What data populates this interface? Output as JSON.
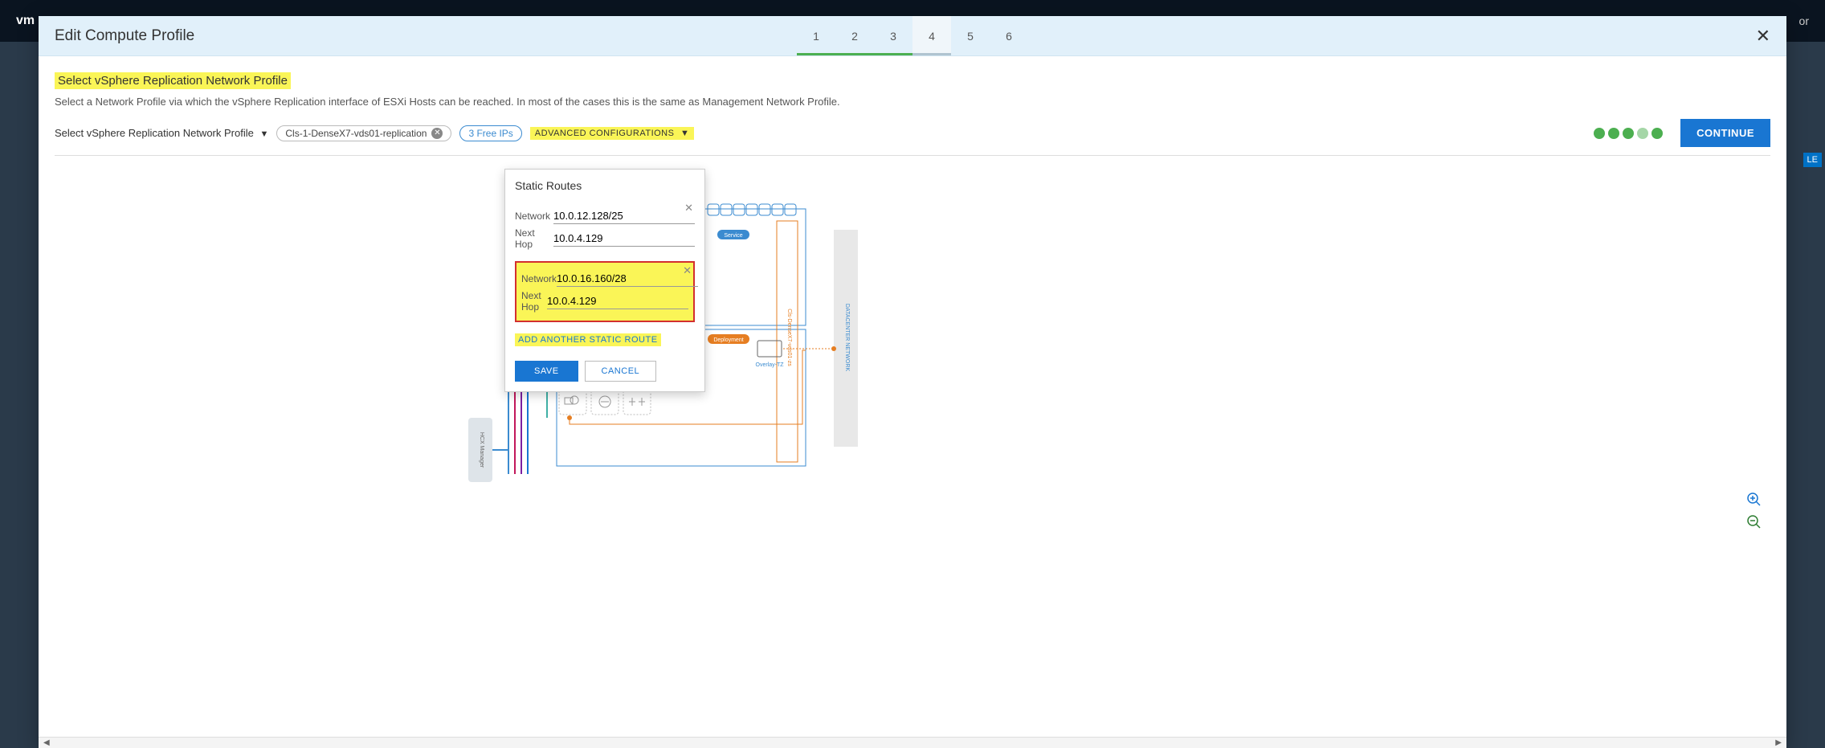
{
  "topbar": {
    "logo": "vm",
    "right": "or"
  },
  "header": {
    "title": "Edit Compute Profile",
    "tabs": [
      "1",
      "2",
      "3",
      "4",
      "5",
      "6"
    ],
    "completed_tabs": [
      0,
      1,
      2
    ],
    "active_tab": 3
  },
  "page": {
    "section_title": "Select vSphere Replication Network Profile",
    "section_desc": "Select a Network Profile via which the vSphere Replication interface of ESXi Hosts can be reached. In most of the cases this is the same as Management Network Profile.",
    "selector_label": "Select vSphere Replication Network Profile",
    "chip_profile": "Cls-1-DenseX7-vds01-replication",
    "chip_ips": "3 Free IPs",
    "adv_label": "ADVANCED CONFIGURATIONS",
    "continue_label": "CONTINUE"
  },
  "popup": {
    "title": "Static Routes",
    "routes": [
      {
        "network_label": "Network",
        "network": "10.0.12.128/25",
        "hop_label": "Next Hop",
        "hop": "10.0.4.129",
        "highlight": false
      },
      {
        "network_label": "Network",
        "network": "10.0.16.160/28",
        "hop_label": "Next Hop",
        "hop": "10.0.4.129",
        "highlight": true
      }
    ],
    "add_label": "ADD ANOTHER STATIC ROUTE",
    "save_label": "SAVE",
    "cancel_label": "CANCEL"
  },
  "diagram": {
    "hcx_label": "HCX Manager",
    "overlay_label": "Overlay-TZ",
    "dc_label": "DATACENTER NETWORK",
    "cluster_label": "Cls-DenseX7-vds01-zs",
    "badge_service": "Service",
    "badge_deploy": "Deployment"
  },
  "side": {
    "le": "LE"
  }
}
